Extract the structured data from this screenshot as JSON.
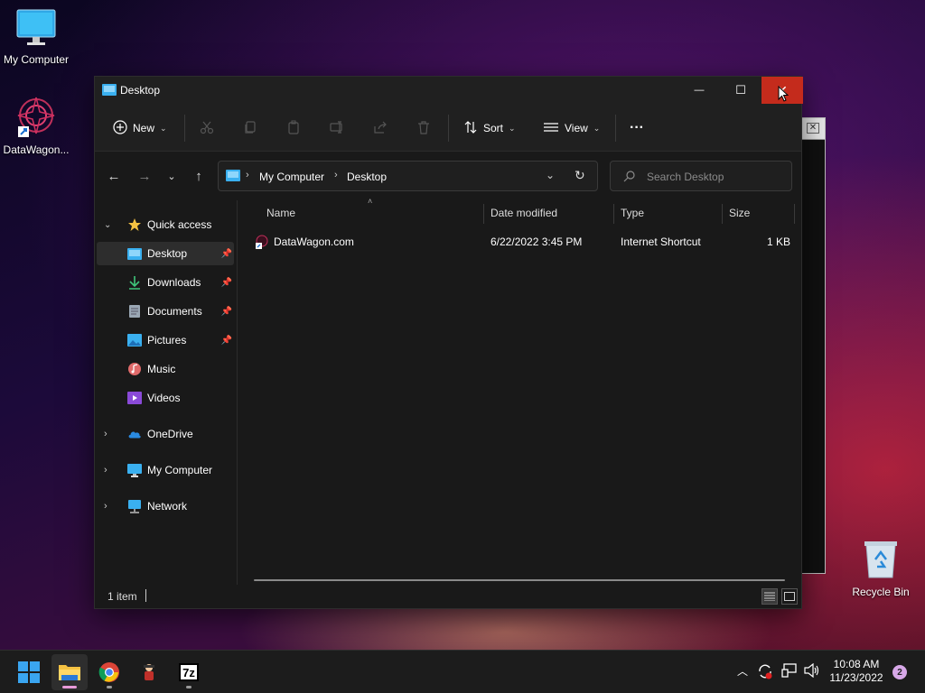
{
  "desktop": {
    "icons": [
      {
        "label": "My Computer"
      },
      {
        "label": "DataWagon..."
      },
      {
        "label": "Recycle Bin"
      }
    ]
  },
  "window": {
    "title": "Desktop",
    "controls": {
      "minimize": "—",
      "maximize": "☐",
      "close": "✕"
    }
  },
  "toolbar": {
    "new_label": "New",
    "sort_label": "Sort",
    "view_label": "View",
    "more_label": "···"
  },
  "address": {
    "crumbs": [
      "My Computer",
      "Desktop"
    ],
    "search_placeholder": "Search Desktop"
  },
  "sidebar": {
    "quick_access": "Quick access",
    "items": [
      {
        "label": "Desktop",
        "pinned": true
      },
      {
        "label": "Downloads",
        "pinned": true
      },
      {
        "label": "Documents",
        "pinned": true
      },
      {
        "label": "Pictures",
        "pinned": true
      },
      {
        "label": "Music",
        "pinned": false
      },
      {
        "label": "Videos",
        "pinned": false
      }
    ],
    "groups": [
      {
        "label": "OneDrive"
      },
      {
        "label": "My Computer"
      },
      {
        "label": "Network"
      }
    ]
  },
  "files": {
    "columns": [
      "Name",
      "Date modified",
      "Type",
      "Size"
    ],
    "rows": [
      {
        "name": "DataWagon.com",
        "date": "6/22/2022 3:45 PM",
        "type": "Internet Shortcut",
        "size": "1 KB"
      }
    ]
  },
  "status": {
    "item_count": "1 item"
  },
  "taskbar": {
    "time": "10:08 AM",
    "date": "11/23/2022",
    "notification_count": "2",
    "apps": [
      "start-icon",
      "file-explorer-icon",
      "chrome-icon",
      "app-icon",
      "7zip-icon"
    ],
    "sevenzip_label": "7z"
  },
  "colors": {
    "window_bg": "#191919",
    "close_red": "#c42b1c",
    "accent_folder": "#f5c242",
    "badge": "#d7a8e8"
  }
}
